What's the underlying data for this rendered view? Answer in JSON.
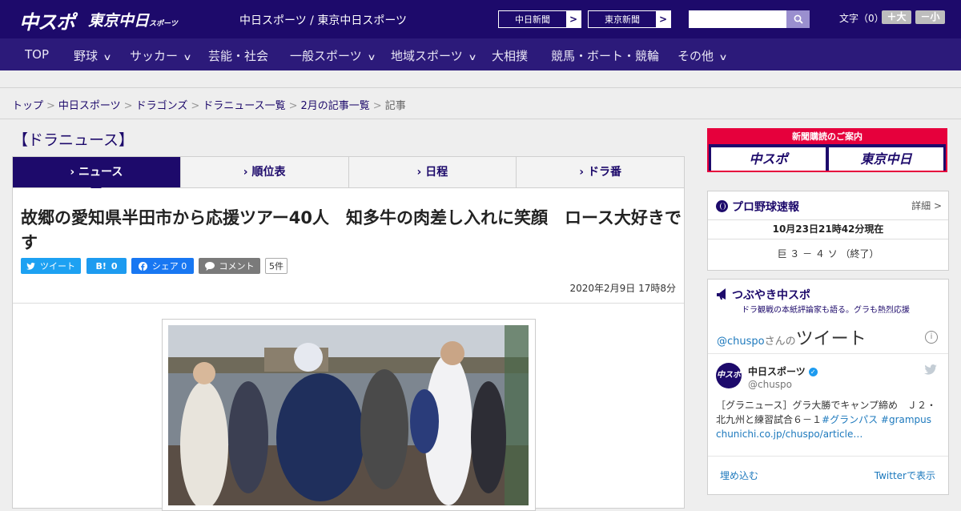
{
  "header": {
    "logo_main": "中スポ",
    "logo_tokyo": "東京中日",
    "logo_tokyo_small": "スポーツ",
    "site_name": "中日スポーツ / 東京中日スポーツ",
    "ext_links": [
      "中日新聞",
      "東京新聞"
    ],
    "ext_arrow": ">",
    "search_placeholder": "",
    "font_size_label": "文字（0）",
    "font_plus": "＋大",
    "font_minus": "－小"
  },
  "nav": {
    "items": [
      {
        "label": "TOP",
        "chev": false
      },
      {
        "label": "野球",
        "chev": true
      },
      {
        "label": "サッカー",
        "chev": true
      },
      {
        "label": "芸能・社会",
        "chev": false
      },
      {
        "label": "一般スポーツ",
        "chev": true
      },
      {
        "label": "地域スポーツ",
        "chev": true
      },
      {
        "label": "大相撲",
        "chev": false
      },
      {
        "label": "競馬・ボート・競輪",
        "chev": false
      },
      {
        "label": "その他",
        "chev": true
      }
    ],
    "chevron": "∨"
  },
  "breadcrumb": {
    "links": [
      "トップ",
      "中日スポーツ",
      "ドラゴンズ",
      "ドラニュース一覧",
      "2月の記事一覧"
    ],
    "current": "記事",
    "sep": ">"
  },
  "section_title": "【ドラニュース】",
  "tabs": [
    "ニュース",
    "順位表",
    "日程",
    "ドラ番"
  ],
  "tab_prefix": "›",
  "article": {
    "title": "故郷の愛知県半田市から応援ツアー40人　知多牛の肉差し入れに笑顔　ロース大好きです",
    "share": {
      "tweet": "ツイート",
      "hatena_icon": "B!",
      "hatena_count": "0",
      "facebook": "シェア 0",
      "comment": "コメント",
      "comment_count": "5件"
    },
    "date": "2020年2月9日 17時8分"
  },
  "sidebar": {
    "subscription": {
      "head": "新聞購読のご案内",
      "btn1": "中スポ",
      "btn2": "東京中日"
    },
    "baseball": {
      "title": "プロ野球速報",
      "more": "詳細 >",
      "time": "10月23日21時42分現在",
      "score": "巨 ３ － ４ ソ （終了）"
    },
    "twitter": {
      "title": "つぶやき中スポ",
      "subtitle": "ドラ観戦の本紙評論家も語る。グラも熱烈応援",
      "handle": "@chuspo",
      "san": "さんの",
      "tweets": "ツイート",
      "info": "i",
      "name": "中日スポーツ",
      "verified": "✓",
      "id": "@chuspo",
      "text": "［グラニュース］グラ大勝でキャンプ締め　Ｊ２・北九州と練習試合６－１",
      "tag1": "#グランパス",
      "tag2": "#grampus",
      "url": "chunichi.co.jp/chuspo/article…",
      "embed": "埋め込む",
      "view": "Twitterで表示",
      "avatar_text": "中スポ"
    }
  }
}
